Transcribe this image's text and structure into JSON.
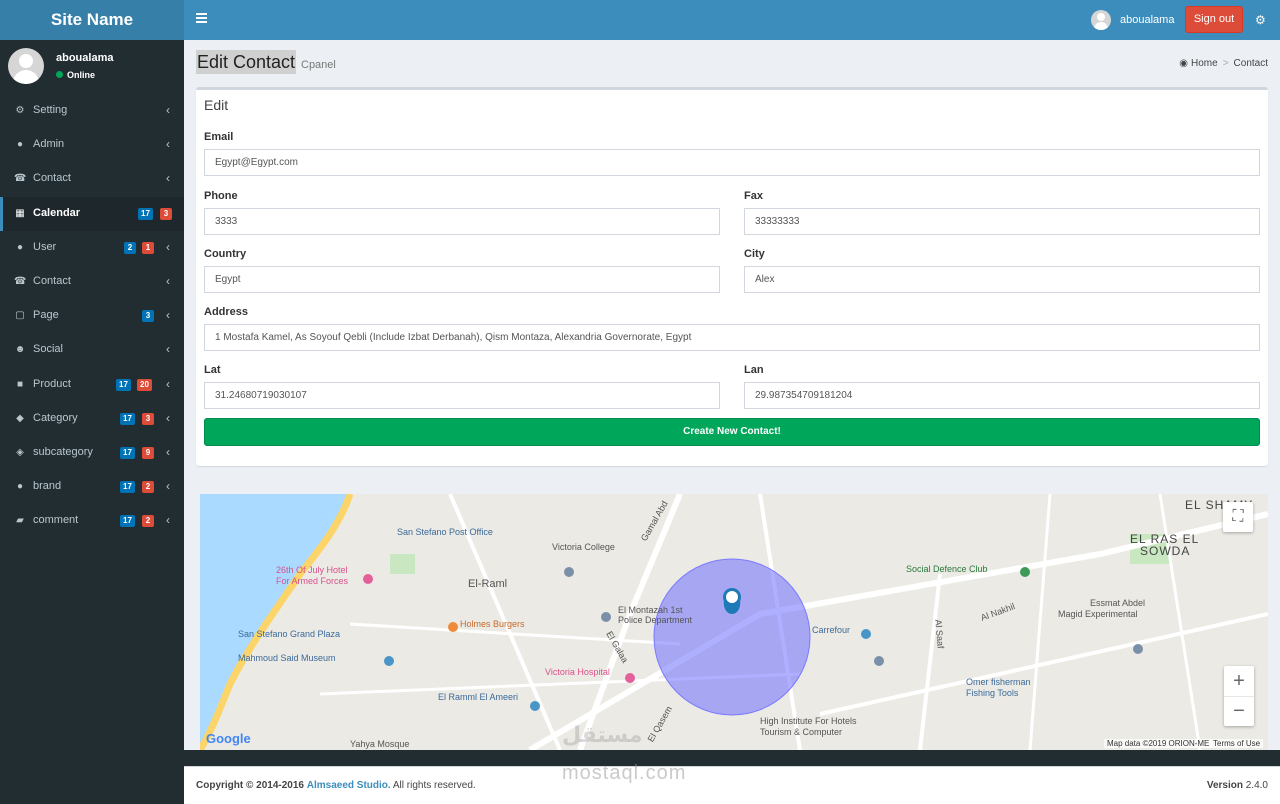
{
  "site_name": "Site Name",
  "user": {
    "name": "aboualama",
    "status": "Online"
  },
  "header": {
    "user_name": "aboualama",
    "signout_label": "Sign out"
  },
  "sidebar": {
    "items": [
      {
        "label": "Setting",
        "icon": "gear-icon",
        "badges": []
      },
      {
        "label": "Admin",
        "icon": "user-icon",
        "badges": []
      },
      {
        "label": "Contact",
        "icon": "phone-icon",
        "badges": []
      },
      {
        "label": "Calendar",
        "icon": "calendar-icon",
        "active": true,
        "badges": [
          "17",
          "3"
        ]
      },
      {
        "label": "User",
        "icon": "user-icon",
        "badges": [
          "2",
          "1"
        ]
      },
      {
        "label": "Contact",
        "icon": "phone-icon",
        "badges": []
      },
      {
        "label": "Page",
        "icon": "page-icon",
        "badges": [
          "3"
        ]
      },
      {
        "label": "Social",
        "icon": "users-icon",
        "badges": []
      },
      {
        "label": "Product",
        "icon": "gift-icon",
        "badges": [
          "17",
          "20"
        ]
      },
      {
        "label": "Category",
        "icon": "tag-icon",
        "badges": [
          "17",
          "3"
        ]
      },
      {
        "label": "subcategory",
        "icon": "tags-icon",
        "badges": [
          "17",
          "9"
        ]
      },
      {
        "label": "brand",
        "icon": "apple-icon",
        "badges": [
          "17",
          "2"
        ]
      },
      {
        "label": "comment",
        "icon": "comments-icon",
        "badges": [
          "17",
          "2"
        ]
      }
    ]
  },
  "page": {
    "title": "Edit Contact",
    "subtitle": "Cpanel"
  },
  "breadcrumb": {
    "home": "Home",
    "current": "Contact"
  },
  "form": {
    "box_title": "Edit",
    "email_label": "Email",
    "email_value": "Egypt@Egypt.com",
    "phone_label": "Phone",
    "phone_value": "3333",
    "fax_label": "Fax",
    "fax_value": "33333333",
    "country_label": "Country",
    "country_value": "Egypt",
    "city_label": "City",
    "city_value": "Alex",
    "address_label": "Address",
    "address_value": "1 Mostafa Kamel, As Soyouf Qebli (Include Izbat Derbanah), Qism Montaza, Alexandria Governorate, Egypt",
    "lat_label": "Lat",
    "lat_value": "31.24680719030107",
    "lan_label": "Lan",
    "lan_value": "29.987354709181204",
    "submit_label": "Create New Contact!"
  },
  "map": {
    "labels": {
      "san_stefano_post": "San Stefano Post Office",
      "victoria_college": "Victoria College",
      "el_raml": "El-Raml",
      "july_hotel": "26th Of July Hotel",
      "armed_forces": "For Armed Forces",
      "holmes": "Holmes Burgers",
      "montazah_police": "El Montazah 1st",
      "police_dept": "Police Department",
      "san_stefano_plaza": "San Stefano Grand Plaza",
      "mahmoud_museum": "Mahmoud Said Museum",
      "victoria_hospital": "Victoria Hospital",
      "raml_ameeri": "El Ramml El Ameeri",
      "social_defence": "Social Defence Club",
      "essmat": "Essmat Abdel",
      "magid": "Magid Experimental",
      "carrefour": "Carrefour",
      "omer": "Omer fisherman",
      "fishing": "Fishing Tools",
      "high_institute": "High Institute For Hotels",
      "tourism": "Tourism & Computer",
      "yahya": "Yahya Mosque",
      "el_shamy": "EL SHAMY",
      "el_ras": "EL RAS EL",
      "sowda": "SOWDA",
      "gamal_abd": "Gamal Abd",
      "el_galaa": "El Galaa",
      "el_qasem": "El Qasem",
      "al_nakhil": "Al Nakhil",
      "al_saaf": "Al Saaf",
      "google": "Google",
      "map_data": "Map data ©2019 ORION-ME",
      "terms": "Terms of Use"
    },
    "zoom_in": "+",
    "zoom_out": "−"
  },
  "watermark": {
    "arabic": "مستقل",
    "latin": "mostaql.com"
  },
  "footer": {
    "copyright_prefix": "Copyright © 2014-2016",
    "studio": "Almsaeed Studio.",
    "rights": "All rights reserved.",
    "version_label": "Version",
    "version_value": "2.4.0"
  },
  "colors": {
    "header": "#3c8dbc",
    "logo": "#367fa9",
    "sidebar": "#222d32",
    "signout": "#dd4b39",
    "submit": "#00a65a"
  }
}
